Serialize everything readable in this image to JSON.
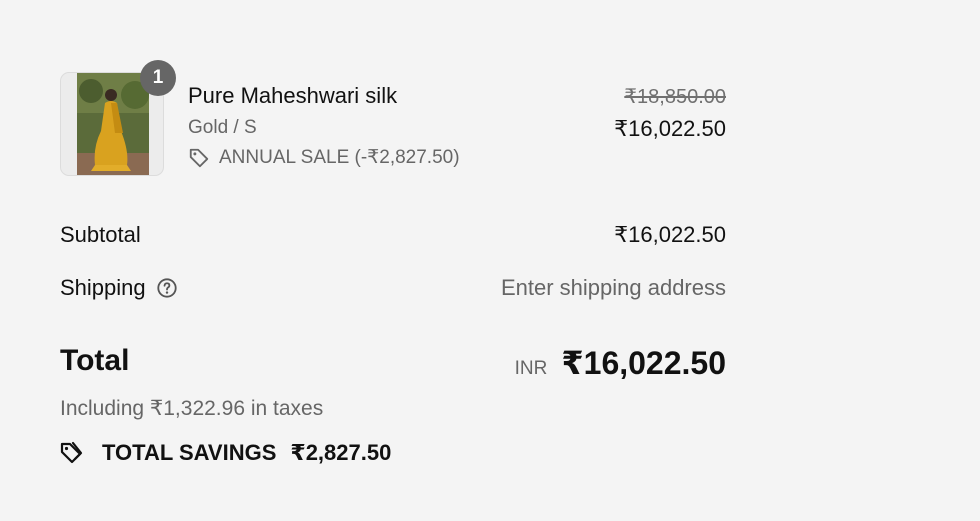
{
  "line_item": {
    "quantity": "1",
    "title": "Pure Maheshwari silk",
    "variant": "Gold / S",
    "discount": "ANNUAL SALE (-₹2,827.50)",
    "original_price": "₹18,850.00",
    "price": "₹16,022.50"
  },
  "subtotal": {
    "label": "Subtotal",
    "value": "₹16,022.50"
  },
  "shipping": {
    "label": "Shipping",
    "value": "Enter shipping address"
  },
  "total": {
    "label": "Total",
    "currency": "INR",
    "amount": "₹16,022.50",
    "tax_note": "Including ₹1,322.96 in taxes"
  },
  "savings": {
    "label": "TOTAL SAVINGS",
    "amount": "₹2,827.50"
  },
  "icons": {
    "discount": "tag-icon",
    "help": "question-circle-icon",
    "savings": "tags-icon"
  },
  "colors": {
    "background": "#f4f4f4",
    "text": "#111111",
    "muted": "#666666",
    "badge": "#666666"
  }
}
